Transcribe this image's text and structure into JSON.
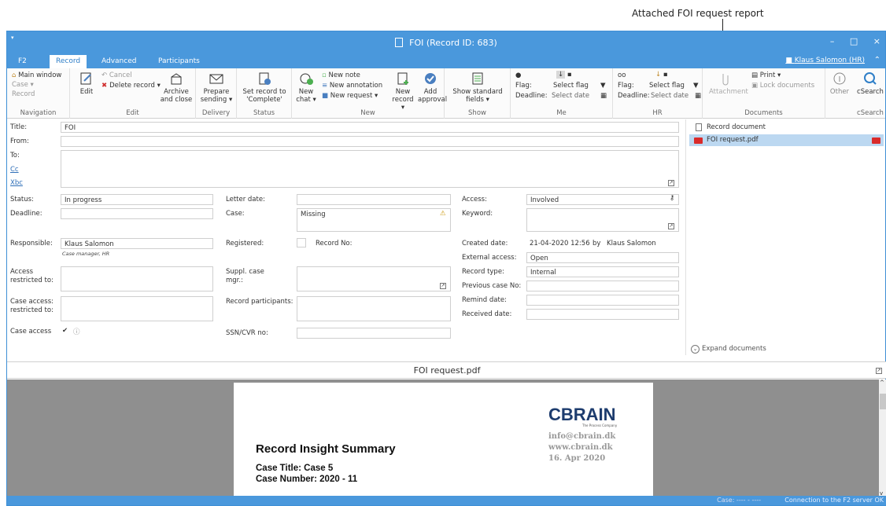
{
  "callout": {
    "text": "Attached FOI request report"
  },
  "window": {
    "title": "FOI (Record ID: 683)",
    "minimize": "–",
    "maximize": "□",
    "close": "×"
  },
  "tabs": [
    {
      "label": "F2"
    },
    {
      "label": "Record"
    },
    {
      "label": "Advanced"
    },
    {
      "label": "Participants"
    }
  ],
  "user": {
    "name": "Klaus Salomon (HR)"
  },
  "ribbon": {
    "navigation": {
      "group": "Navigation",
      "main_window": "Main window",
      "case": "Case ▾",
      "record": "Record"
    },
    "edit": {
      "group": "Edit",
      "edit": "Edit",
      "cancel": "Cancel",
      "delete_record": "Delete record ▾",
      "archive_close": "Archive and close"
    },
    "delivery": {
      "group": "Delivery",
      "prepare_sending": "Prepare sending ▾"
    },
    "status": {
      "group": "Status",
      "set_complete": "Set record to 'Complete'"
    },
    "new": {
      "group": "New",
      "new_chat": "New chat ▾",
      "new_note": "New note",
      "new_annotation": "New annotation",
      "new_request": "New request ▾",
      "new_record": "New record ▾",
      "add_approval": "Add approval"
    },
    "show": {
      "group": "Show",
      "show_standard": "Show standard fields ▾"
    },
    "me": {
      "group": "Me",
      "flag_label": "Flag:",
      "flag_value": "Select flag",
      "deadline_label": "Deadline:",
      "deadline_value": "Select date"
    },
    "hr": {
      "group": "HR",
      "flag_label": "Flag:",
      "flag_value": "Select flag",
      "deadline_label": "Deadline:",
      "deadline_value": "Select date"
    },
    "documents": {
      "group": "Documents",
      "attachment": "Attachment",
      "print": "Print ▾",
      "lock_documents": "Lock documents"
    },
    "other": {
      "label": "Other"
    },
    "csearch": {
      "group": "cSearch",
      "label": "cSearch"
    }
  },
  "form": {
    "title_label": "Title:",
    "title_value": "FOI",
    "from_label": "From:",
    "to_label": "To:",
    "cc_label": "Cc",
    "xbc_label": "Xbc",
    "status_label": "Status:",
    "status_value": "In progress",
    "letter_date_label": "Letter date:",
    "access_label": "Access:",
    "access_value": "Involved",
    "deadline_label": "Deadline:",
    "case_label": "Case:",
    "case_value": "Missing",
    "keyword_label": "Keyword:",
    "responsible_label": "Responsible:",
    "responsible_value": "Klaus Salomon",
    "responsible_sub": "Case manager, HR",
    "registered_label": "Registered:",
    "record_no_label": "Record No:",
    "created_date_label": "Created date:",
    "created_date_value": "21-04-2020 12:56",
    "by_label": "by",
    "created_by": "Klaus Salomon",
    "external_access_label": "External access:",
    "external_access_value": "Open",
    "access_restricted_label": "Access restricted to:",
    "suppl_case_mgr_label": "Suppl. case mgr.:",
    "record_type_label": "Record type:",
    "record_type_value": "Internal",
    "previous_case_label": "Previous case No:",
    "case_access_restricted_label": "Case access: restricted to:",
    "record_participants_label": "Record participants:",
    "remind_date_label": "Remind date:",
    "received_date_label": "Received date:",
    "case_access_label": "Case access",
    "ssn_label": "SSN/CVR no:"
  },
  "documents": {
    "items": [
      {
        "name": "Record document"
      },
      {
        "name": "FOI request.pdf"
      }
    ],
    "expand": "Expand documents"
  },
  "preview": {
    "filename": "FOI request.pdf",
    "heading": "Record Insight Summary",
    "case_title": "Case Title: Case 5",
    "case_number": "Case Number: 2020 - 11",
    "logo": "CBRAIN",
    "logo_sub": "The Process Company",
    "email": "info@cbrain.dk",
    "web": "www.cbrain.dk",
    "date": "16. Apr 2020"
  },
  "statusbar": {
    "case": "Case: ---- - ----",
    "connection": "Connection to the F2 server OK"
  }
}
